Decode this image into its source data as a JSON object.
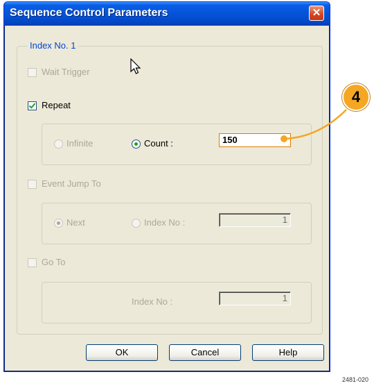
{
  "dialog": {
    "title": "Sequence Control Parameters",
    "close_glyph": "✕"
  },
  "group": {
    "legend": "Index No. 1"
  },
  "wait_trigger": {
    "label": "Wait Trigger",
    "checked": false,
    "enabled": false
  },
  "repeat": {
    "label": "Repeat",
    "checked": true,
    "infinite_label": "Infinite",
    "count_label": "Count :",
    "count_value": "150"
  },
  "event_jump": {
    "label": "Event Jump To",
    "checked": false,
    "next_label": "Next",
    "index_label": "Index No :",
    "index_value": "1"
  },
  "go_to": {
    "label": "Go To",
    "checked": false,
    "index_label": "Index No :",
    "index_value": "1"
  },
  "buttons": {
    "ok": "OK",
    "cancel": "Cancel",
    "help": "Help"
  },
  "callout": {
    "number": "4",
    "color": "#f5a623"
  },
  "figure_id": "2481-020",
  "colors": {
    "title_bar": "#0453d9",
    "dialog_bg": "#ece9d8",
    "legend": "#0046d5"
  }
}
